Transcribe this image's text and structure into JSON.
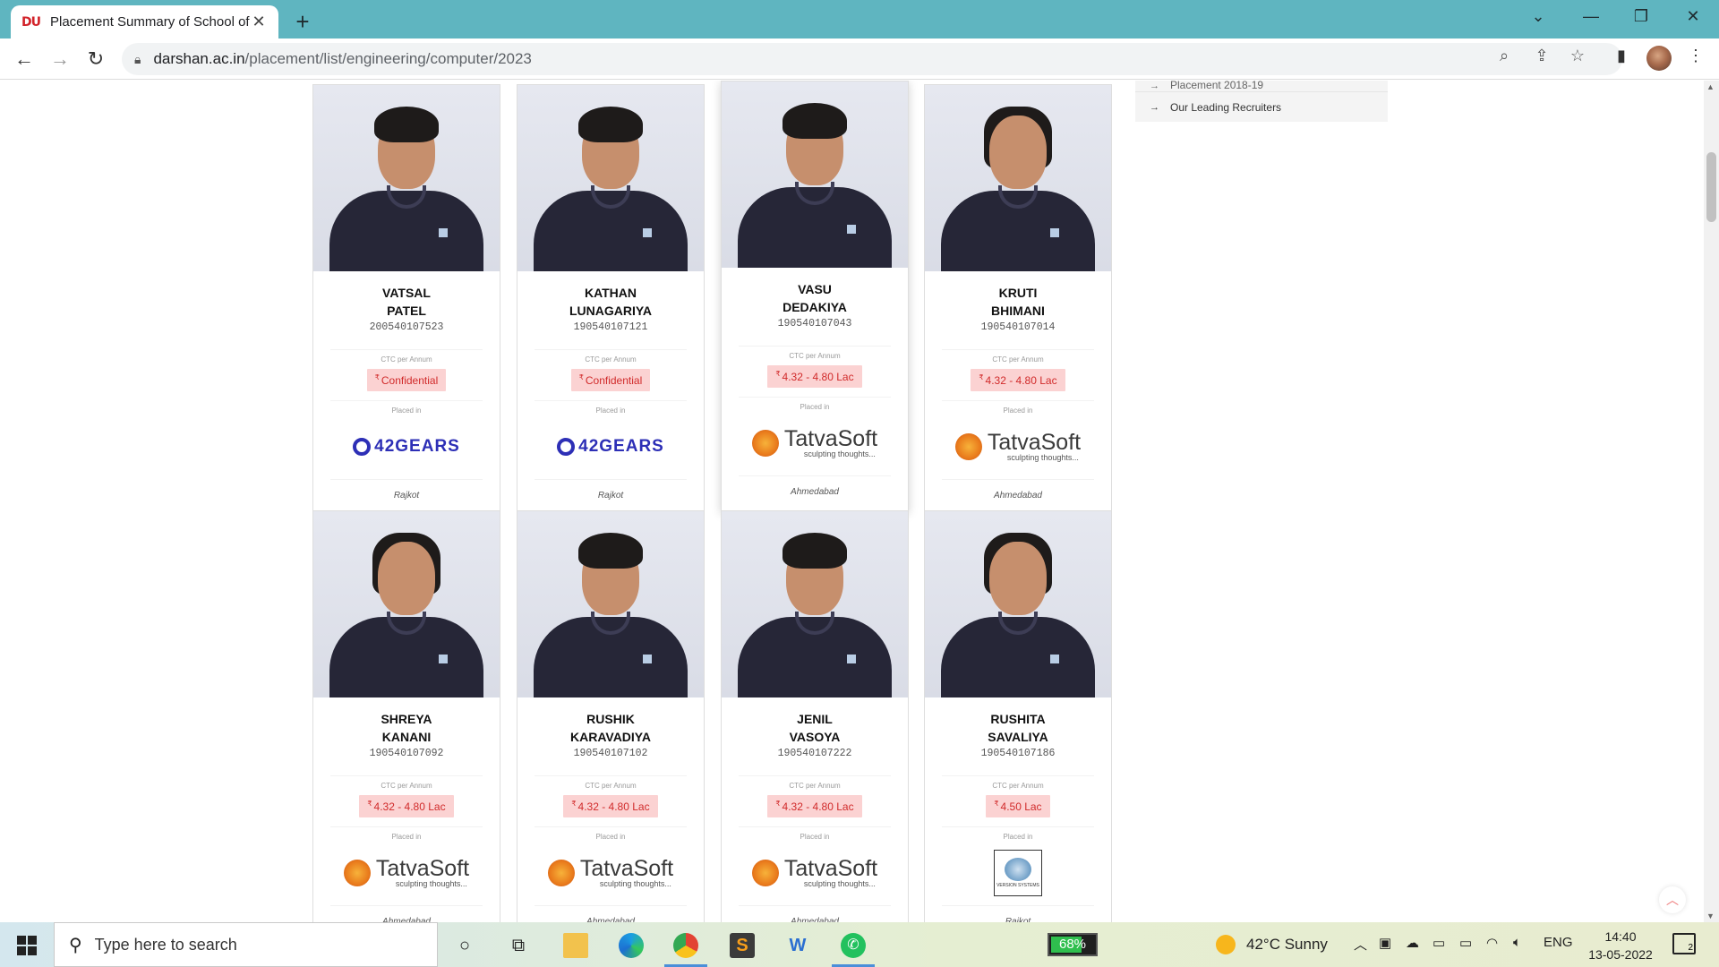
{
  "browser": {
    "tab_title": "Placement Summary of School of",
    "tab_favicon": "DU",
    "url_host": "darshan.ac.in",
    "url_path": "/placement/list/engineering/computer/2023"
  },
  "sidebar": {
    "items": [
      {
        "label": "Placement 2018-19"
      },
      {
        "label": "Our Leading Recruiters"
      }
    ]
  },
  "cards": [
    {
      "first": "VATSAL",
      "last": "PATEL",
      "enrollment": "200540107523",
      "ctc_label": "CTC per Annum",
      "ctc": "Confidential",
      "placed_label": "Placed in",
      "company": "42GEARS",
      "logo": "42gears",
      "city": "Rajkot"
    },
    {
      "first": "KATHAN",
      "last": "LUNAGARIYA",
      "enrollment": "190540107121",
      "ctc_label": "CTC per Annum",
      "ctc": "Confidential",
      "placed_label": "Placed in",
      "company": "42GEARS",
      "logo": "42gears",
      "city": "Rajkot"
    },
    {
      "first": "VASU",
      "last": "DEDAKIYA",
      "enrollment": "190540107043",
      "ctc_label": "CTC per Annum",
      "ctc": "4.32 - 4.80 Lac",
      "placed_label": "Placed in",
      "company": "TatvaSoft",
      "tagline": "sculpting thoughts...",
      "logo": "tatvasoft",
      "city": "Ahmedabad"
    },
    {
      "first": "KRUTI",
      "last": "BHIMANI",
      "enrollment": "190540107014",
      "ctc_label": "CTC per Annum",
      "ctc": "4.32 - 4.80 Lac",
      "placed_label": "Placed in",
      "company": "TatvaSoft",
      "tagline": "sculpting thoughts...",
      "logo": "tatvasoft",
      "city": "Ahmedabad"
    },
    {
      "first": "SHREYA",
      "last": "KANANI",
      "enrollment": "190540107092",
      "ctc_label": "CTC per Annum",
      "ctc": "4.32 - 4.80 Lac",
      "placed_label": "Placed in",
      "company": "TatvaSoft",
      "tagline": "sculpting thoughts...",
      "logo": "tatvasoft",
      "city": "Ahmedabad"
    },
    {
      "first": "RUSHIK",
      "last": "KARAVADIYA",
      "enrollment": "190540107102",
      "ctc_label": "CTC per Annum",
      "ctc": "4.32 - 4.80 Lac",
      "placed_label": "Placed in",
      "company": "TatvaSoft",
      "tagline": "sculpting thoughts...",
      "logo": "tatvasoft",
      "city": "Ahmedabad"
    },
    {
      "first": "JENIL",
      "last": "VASOYA",
      "enrollment": "190540107222",
      "ctc_label": "CTC per Annum",
      "ctc": "4.32 - 4.80 Lac",
      "placed_label": "Placed in",
      "company": "TatvaSoft",
      "tagline": "sculpting thoughts...",
      "logo": "tatvasoft",
      "city": "Ahmedabad"
    },
    {
      "first": "RUSHITA",
      "last": "SAVALIYA",
      "enrollment": "190540107186",
      "ctc_label": "CTC per Annum",
      "ctc": "4.50 Lac",
      "placed_label": "Placed in",
      "company": "VERSION SYSTEMS",
      "logo": "version",
      "city": "Rajkot"
    }
  ],
  "currency_symbol": "₹",
  "taskbar": {
    "search_placeholder": "Type here to search",
    "battery": "68%",
    "weather": "42°C  Sunny",
    "lang": "ENG",
    "time": "14:40",
    "date": "13-05-2022",
    "notifications": "2"
  }
}
